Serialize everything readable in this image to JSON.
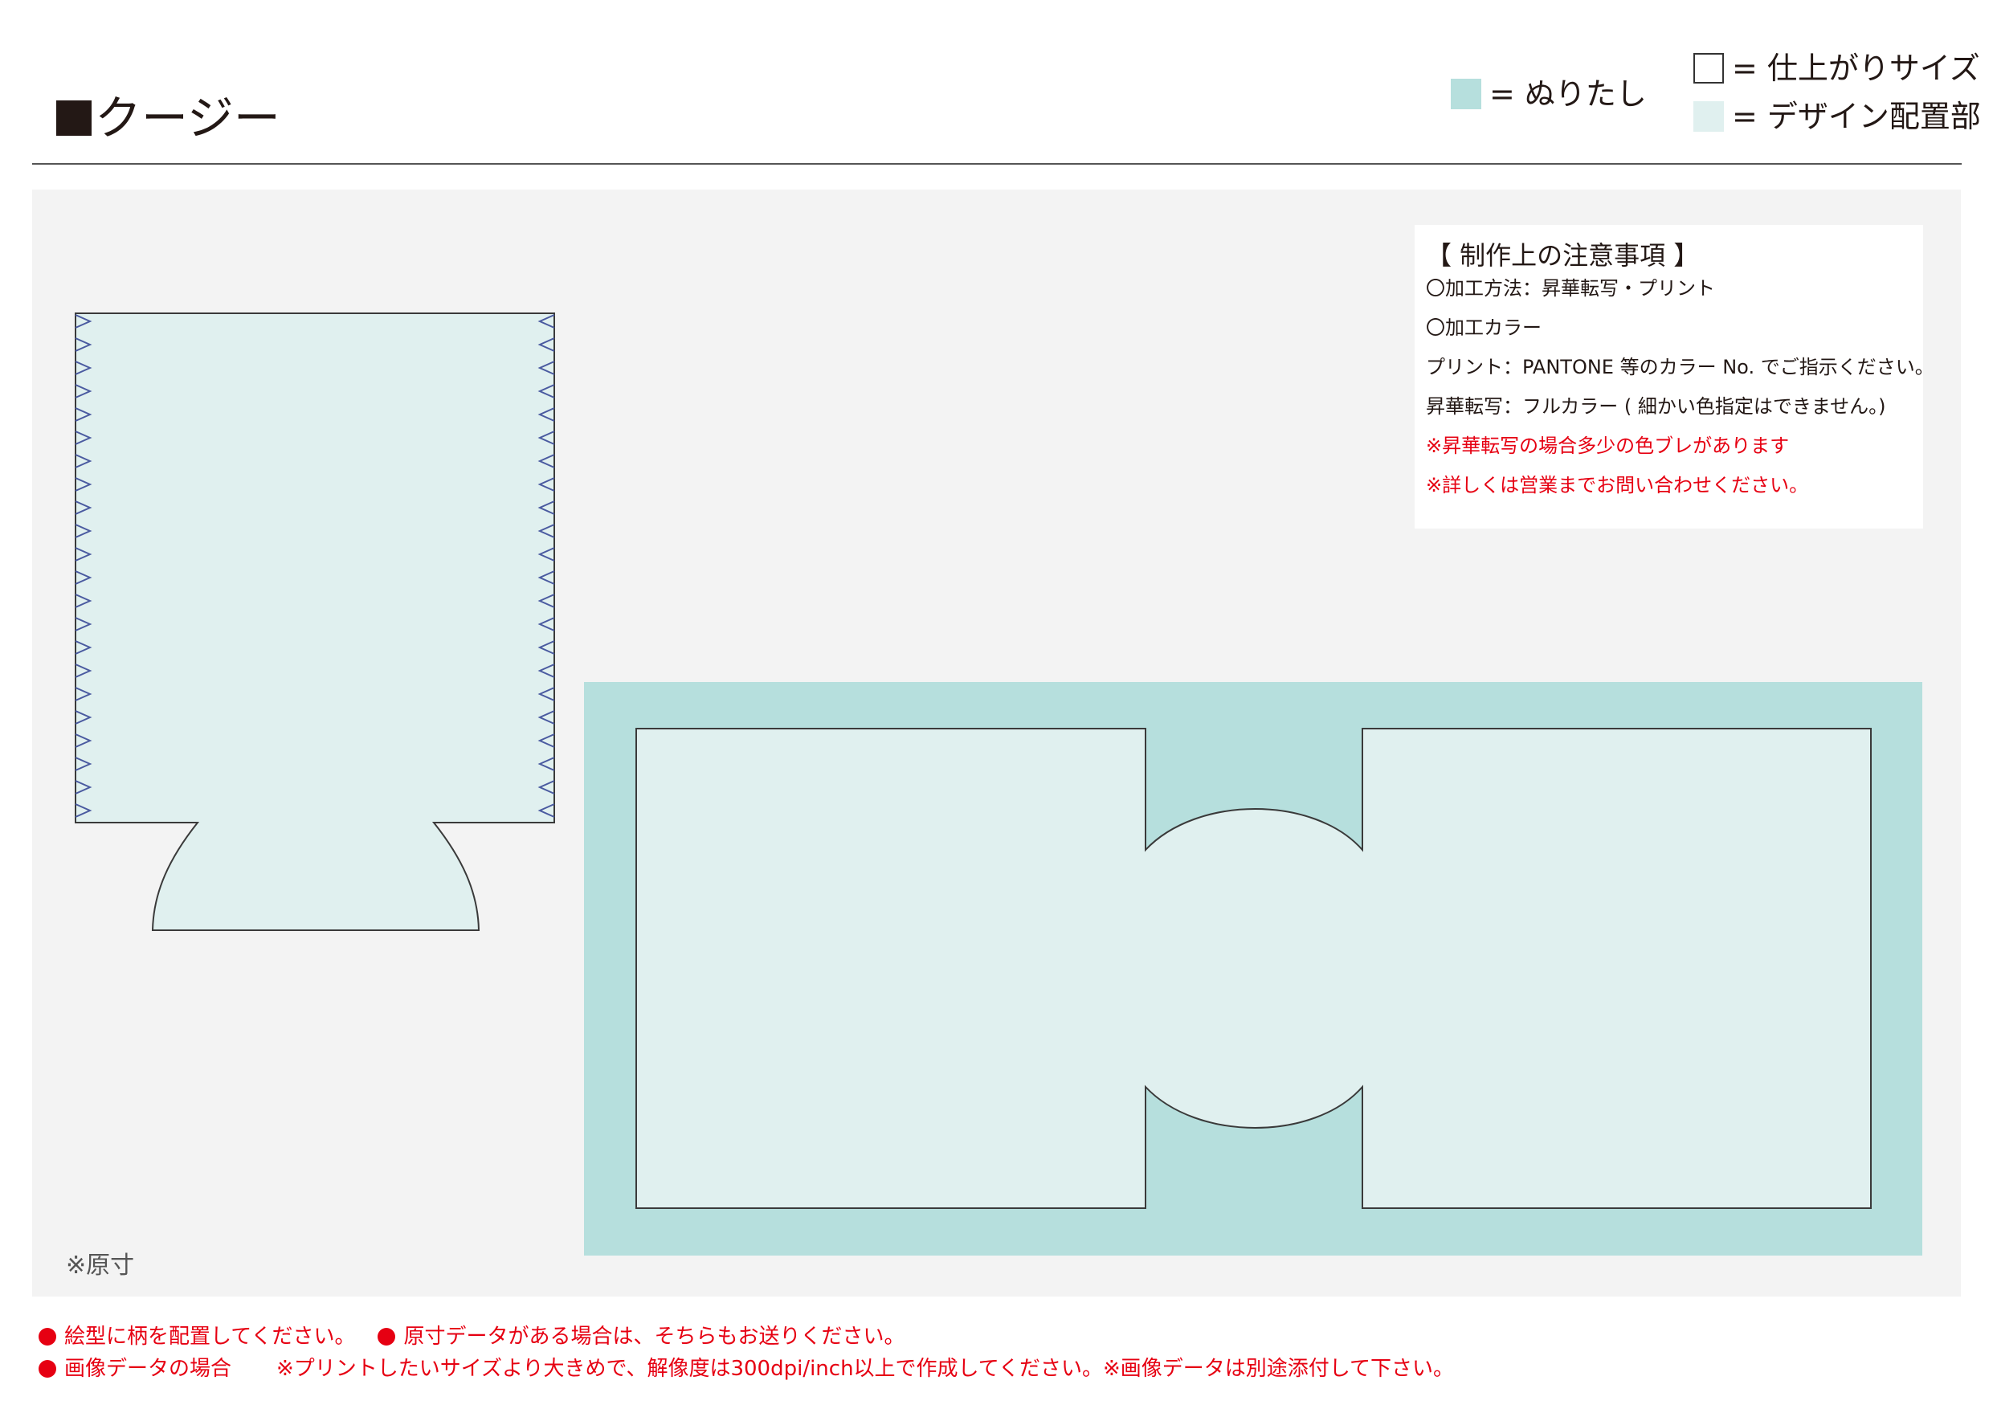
{
  "title": "クージー",
  "legend": {
    "bleed": "= ぬりたし",
    "finish": "= 仕上がりサイズ",
    "design": "= デザイン配置部"
  },
  "notes": {
    "title": "【 制作上の注意事項 】",
    "lines": [
      "〇加工方法：昇華転写・プリント",
      "〇加工カラー",
      "プリント：PANTONE 等のカラー No. でご指示ください。",
      "昇華転写：フルカラー ( 細かい色指定はできません。)"
    ],
    "warnings": [
      "※昇華転写の場合多少の色ブレがあります",
      "※詳しくは営業までお問い合わせください。"
    ]
  },
  "scale_note": "※原寸",
  "footer": {
    "item1": "絵型に柄を配置してください。",
    "item2": "原寸データがある場合は、そちらもお送りください。",
    "item3": "画像データの場合",
    "item3_detail": "※プリントしたいサイズより大きめで、解像度は300dpi/inch以上で作成してください。※画像データは別途添付して下さい。"
  },
  "colors": {
    "bleed": "#b6dfdd",
    "design": "#e0f0ef",
    "panel": "#f3f3f3",
    "stitch": "#4a5aa0",
    "alert": "#e60012"
  }
}
